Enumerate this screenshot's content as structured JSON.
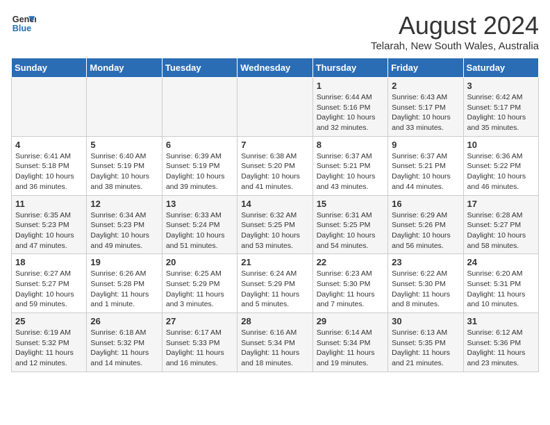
{
  "header": {
    "logo_line1": "General",
    "logo_line2": "Blue",
    "title": "August 2024",
    "subtitle": "Telarah, New South Wales, Australia"
  },
  "weekdays": [
    "Sunday",
    "Monday",
    "Tuesday",
    "Wednesday",
    "Thursday",
    "Friday",
    "Saturday"
  ],
  "weeks": [
    [
      {
        "day": "",
        "info": ""
      },
      {
        "day": "",
        "info": ""
      },
      {
        "day": "",
        "info": ""
      },
      {
        "day": "",
        "info": ""
      },
      {
        "day": "1",
        "info": "Sunrise: 6:44 AM\nSunset: 5:16 PM\nDaylight: 10 hours\nand 32 minutes."
      },
      {
        "day": "2",
        "info": "Sunrise: 6:43 AM\nSunset: 5:17 PM\nDaylight: 10 hours\nand 33 minutes."
      },
      {
        "day": "3",
        "info": "Sunrise: 6:42 AM\nSunset: 5:17 PM\nDaylight: 10 hours\nand 35 minutes."
      }
    ],
    [
      {
        "day": "4",
        "info": "Sunrise: 6:41 AM\nSunset: 5:18 PM\nDaylight: 10 hours\nand 36 minutes."
      },
      {
        "day": "5",
        "info": "Sunrise: 6:40 AM\nSunset: 5:19 PM\nDaylight: 10 hours\nand 38 minutes."
      },
      {
        "day": "6",
        "info": "Sunrise: 6:39 AM\nSunset: 5:19 PM\nDaylight: 10 hours\nand 39 minutes."
      },
      {
        "day": "7",
        "info": "Sunrise: 6:38 AM\nSunset: 5:20 PM\nDaylight: 10 hours\nand 41 minutes."
      },
      {
        "day": "8",
        "info": "Sunrise: 6:37 AM\nSunset: 5:21 PM\nDaylight: 10 hours\nand 43 minutes."
      },
      {
        "day": "9",
        "info": "Sunrise: 6:37 AM\nSunset: 5:21 PM\nDaylight: 10 hours\nand 44 minutes."
      },
      {
        "day": "10",
        "info": "Sunrise: 6:36 AM\nSunset: 5:22 PM\nDaylight: 10 hours\nand 46 minutes."
      }
    ],
    [
      {
        "day": "11",
        "info": "Sunrise: 6:35 AM\nSunset: 5:23 PM\nDaylight: 10 hours\nand 47 minutes."
      },
      {
        "day": "12",
        "info": "Sunrise: 6:34 AM\nSunset: 5:23 PM\nDaylight: 10 hours\nand 49 minutes."
      },
      {
        "day": "13",
        "info": "Sunrise: 6:33 AM\nSunset: 5:24 PM\nDaylight: 10 hours\nand 51 minutes."
      },
      {
        "day": "14",
        "info": "Sunrise: 6:32 AM\nSunset: 5:25 PM\nDaylight: 10 hours\nand 53 minutes."
      },
      {
        "day": "15",
        "info": "Sunrise: 6:31 AM\nSunset: 5:25 PM\nDaylight: 10 hours\nand 54 minutes."
      },
      {
        "day": "16",
        "info": "Sunrise: 6:29 AM\nSunset: 5:26 PM\nDaylight: 10 hours\nand 56 minutes."
      },
      {
        "day": "17",
        "info": "Sunrise: 6:28 AM\nSunset: 5:27 PM\nDaylight: 10 hours\nand 58 minutes."
      }
    ],
    [
      {
        "day": "18",
        "info": "Sunrise: 6:27 AM\nSunset: 5:27 PM\nDaylight: 10 hours\nand 59 minutes."
      },
      {
        "day": "19",
        "info": "Sunrise: 6:26 AM\nSunset: 5:28 PM\nDaylight: 11 hours\nand 1 minute."
      },
      {
        "day": "20",
        "info": "Sunrise: 6:25 AM\nSunset: 5:29 PM\nDaylight: 11 hours\nand 3 minutes."
      },
      {
        "day": "21",
        "info": "Sunrise: 6:24 AM\nSunset: 5:29 PM\nDaylight: 11 hours\nand 5 minutes."
      },
      {
        "day": "22",
        "info": "Sunrise: 6:23 AM\nSunset: 5:30 PM\nDaylight: 11 hours\nand 7 minutes."
      },
      {
        "day": "23",
        "info": "Sunrise: 6:22 AM\nSunset: 5:30 PM\nDaylight: 11 hours\nand 8 minutes."
      },
      {
        "day": "24",
        "info": "Sunrise: 6:20 AM\nSunset: 5:31 PM\nDaylight: 11 hours\nand 10 minutes."
      }
    ],
    [
      {
        "day": "25",
        "info": "Sunrise: 6:19 AM\nSunset: 5:32 PM\nDaylight: 11 hours\nand 12 minutes."
      },
      {
        "day": "26",
        "info": "Sunrise: 6:18 AM\nSunset: 5:32 PM\nDaylight: 11 hours\nand 14 minutes."
      },
      {
        "day": "27",
        "info": "Sunrise: 6:17 AM\nSunset: 5:33 PM\nDaylight: 11 hours\nand 16 minutes."
      },
      {
        "day": "28",
        "info": "Sunrise: 6:16 AM\nSunset: 5:34 PM\nDaylight: 11 hours\nand 18 minutes."
      },
      {
        "day": "29",
        "info": "Sunrise: 6:14 AM\nSunset: 5:34 PM\nDaylight: 11 hours\nand 19 minutes."
      },
      {
        "day": "30",
        "info": "Sunrise: 6:13 AM\nSunset: 5:35 PM\nDaylight: 11 hours\nand 21 minutes."
      },
      {
        "day": "31",
        "info": "Sunrise: 6:12 AM\nSunset: 5:36 PM\nDaylight: 11 hours\nand 23 minutes."
      }
    ]
  ]
}
